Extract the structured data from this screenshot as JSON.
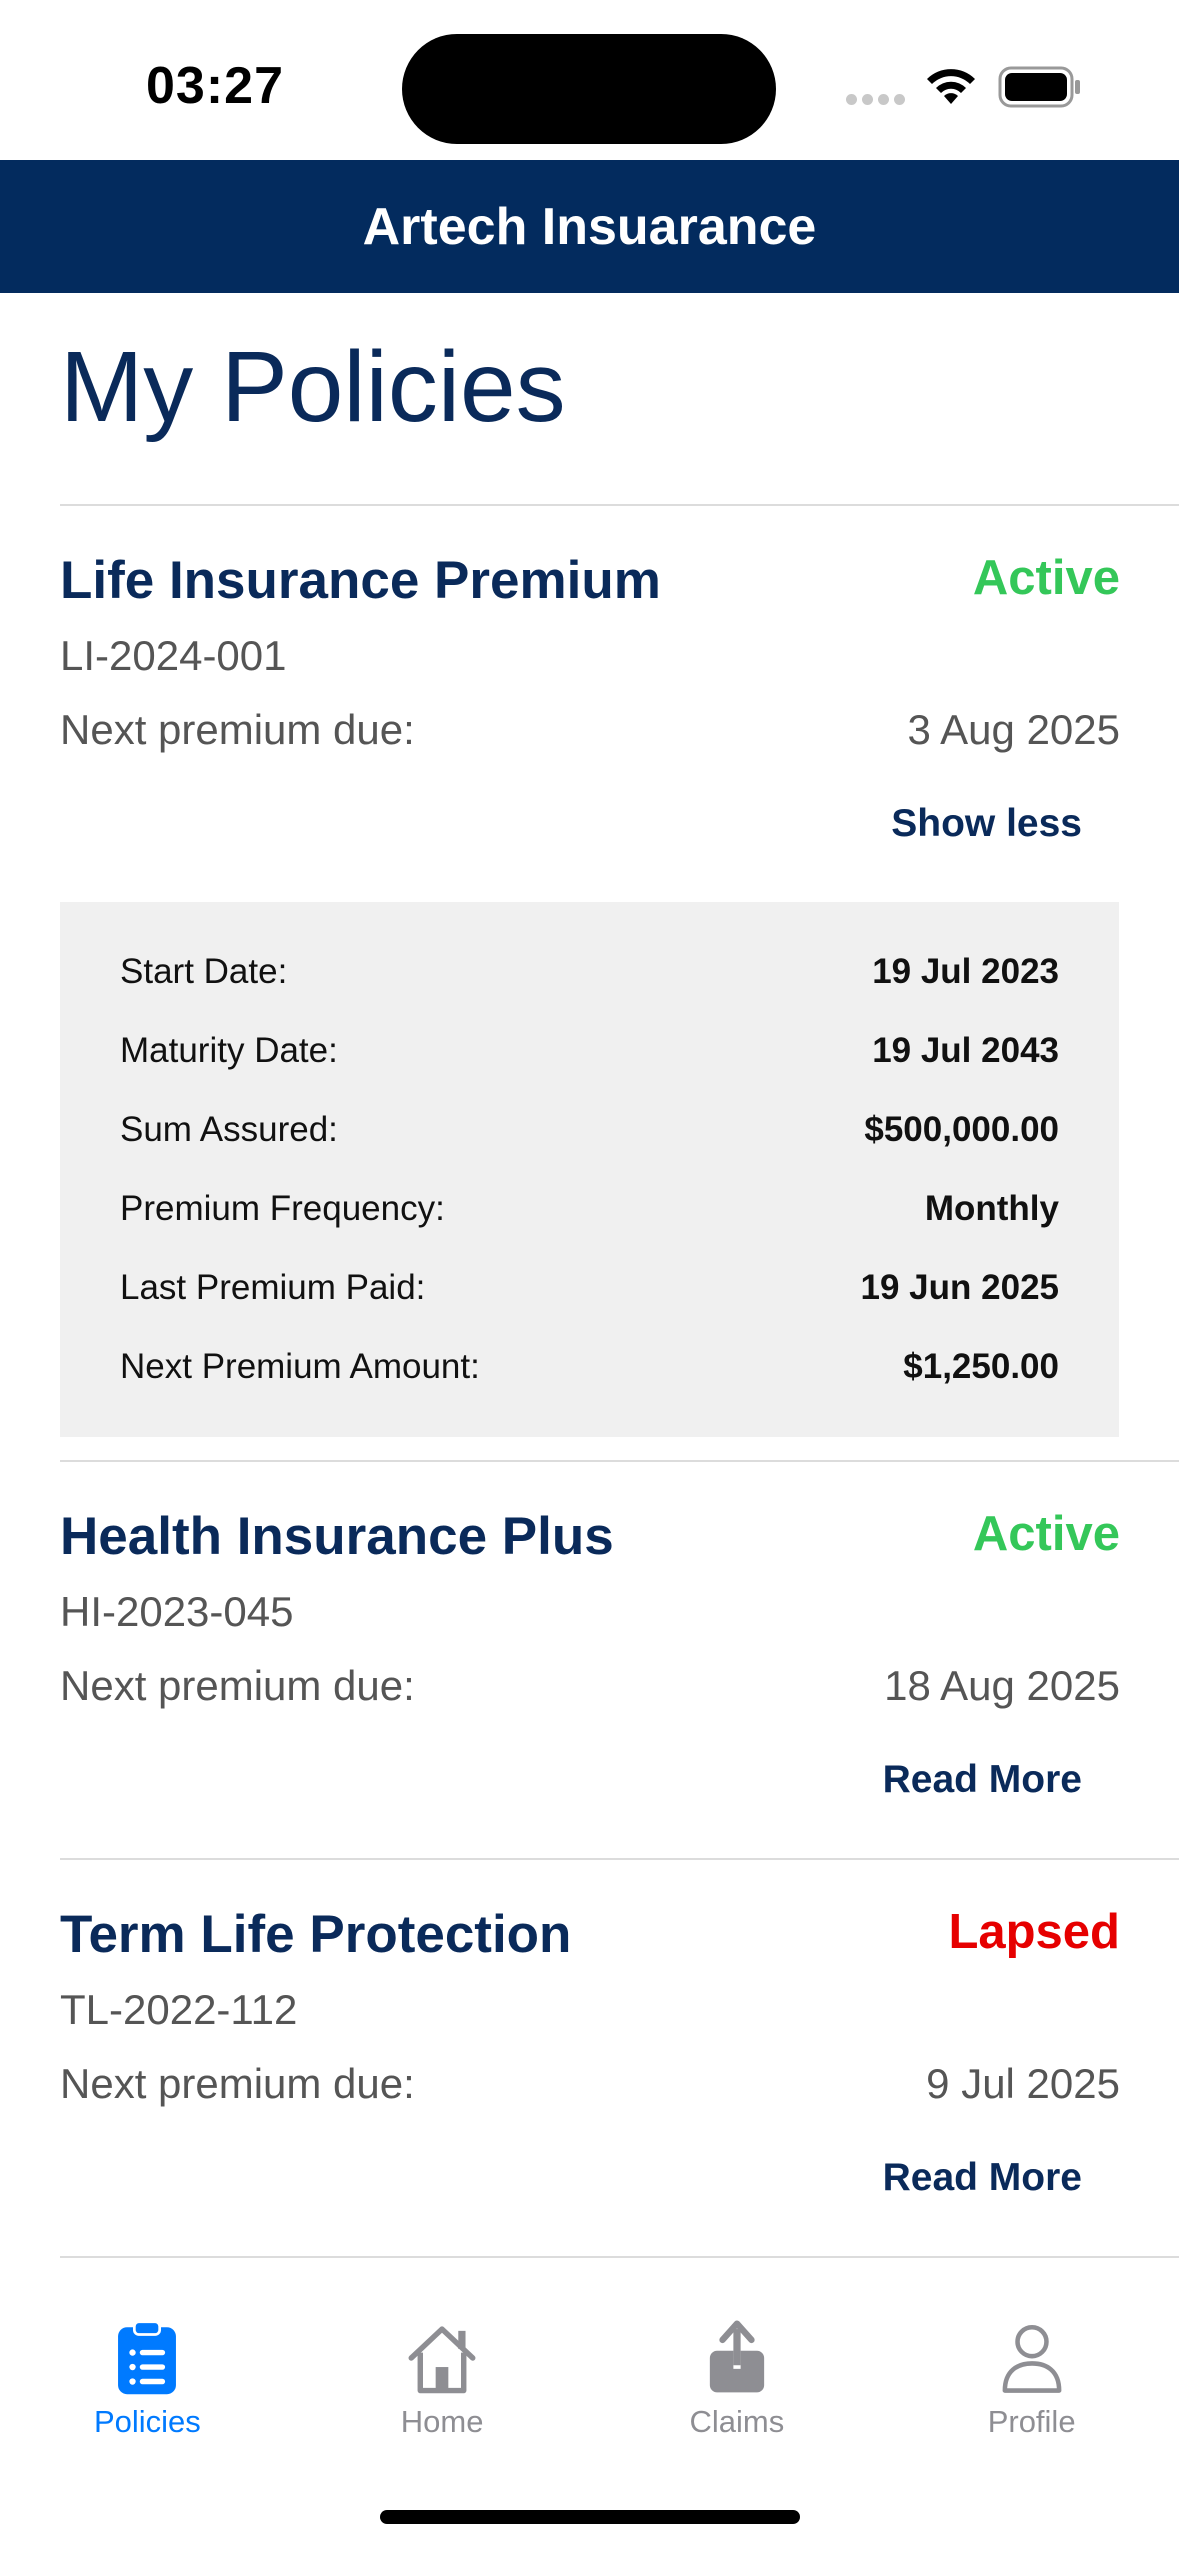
{
  "status_bar": {
    "time": "03:27"
  },
  "header": {
    "title": "Artech Insuarance"
  },
  "page": {
    "title": "My Policies"
  },
  "policies": [
    {
      "name": "Life Insurance Premium",
      "status": "Active",
      "number": "LI-2024-001",
      "due_label": "Next premium due:",
      "due_date": "3 Aug 2025",
      "toggle_label": "Show less",
      "expanded": true,
      "details": [
        {
          "label": "Start Date:",
          "value": "19 Jul 2023"
        },
        {
          "label": "Maturity Date:",
          "value": "19 Jul 2043"
        },
        {
          "label": "Sum Assured:",
          "value": "$500,000.00"
        },
        {
          "label": "Premium Frequency:",
          "value": "Monthly"
        },
        {
          "label": "Last Premium Paid:",
          "value": "19 Jun 2025"
        },
        {
          "label": "Next Premium Amount:",
          "value": "$1,250.00"
        }
      ]
    },
    {
      "name": "Health Insurance Plus",
      "status": "Active",
      "number": "HI-2023-045",
      "due_label": "Next premium due:",
      "due_date": "18 Aug 2025",
      "toggle_label": "Read More",
      "expanded": false
    },
    {
      "name": "Term Life Protection",
      "status": "Lapsed",
      "number": "TL-2022-112",
      "due_label": "Next premium due:",
      "due_date": "9 Jul 2025",
      "toggle_label": "Read More",
      "expanded": false
    }
  ],
  "tab_bar": {
    "active": "Policies",
    "tabs": [
      {
        "label": "Policies",
        "icon": "clipboard-list-icon"
      },
      {
        "label": "Home",
        "icon": "house-icon"
      },
      {
        "label": "Claims",
        "icon": "share-upload-icon"
      },
      {
        "label": "Profile",
        "icon": "person-icon"
      }
    ]
  },
  "colors": {
    "brand_navy": "#032b5e",
    "title_navy": "#0a2a5a",
    "active_green": "#34c759",
    "lapsed_red": "#e60000",
    "tab_active_blue": "#007aff",
    "tab_inactive_gray": "#8e8e93"
  }
}
